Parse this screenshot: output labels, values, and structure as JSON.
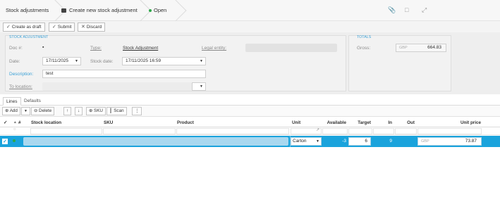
{
  "breadcrumb": {
    "item1": "Stock adjustments",
    "item2": "Create new stock adjustment",
    "item3": "Open",
    "status_color": "#2ea84a"
  },
  "top_icons": [
    "paperclip-icon",
    "chat-icon",
    "expand-icon"
  ],
  "actions": {
    "create_draft": "Create as draft",
    "submit": "Submit",
    "discard": "Discard"
  },
  "form": {
    "section_title": "STOCK ADJUSTMENT",
    "doc_label": "Doc #:",
    "doc_value": "",
    "type_label": "Type:",
    "type_value": "Stock Adjustment",
    "legal_entity_label": "Legal entity:",
    "date_label": "Date:",
    "date_value": "17/11/2025",
    "stock_date_label": "Stock date:",
    "stock_date_value": "17/11/2025 16:59",
    "description_label": "Description:",
    "description_value": "test",
    "to_location_label": "To location:"
  },
  "totals": {
    "title": "TOTALS",
    "gross_label": "Gross:",
    "currency": "GBP",
    "gross_value": "664.83"
  },
  "tabs": [
    "Lines",
    "Defaults"
  ],
  "grid_toolbar": {
    "add": "Add",
    "delete": "Delete",
    "sku": "SKU",
    "scan": "Scan"
  },
  "grid": {
    "columns": {
      "hash": "#",
      "stock_location": "Stock location",
      "sku": "SKU",
      "product": "Product",
      "unit": "Unit",
      "available": "Available",
      "target": "Target",
      "in": "In",
      "out": "Out",
      "unit_price": "Unit price"
    },
    "rows": [
      {
        "unit": "Carton",
        "available": "-3",
        "target": "6",
        "in": "9",
        "out": "",
        "currency": "GBP",
        "unit_price": "73.87"
      }
    ]
  },
  "colors": {
    "accent": "#3aa0d6",
    "selected_row": "#1aa3dc"
  }
}
